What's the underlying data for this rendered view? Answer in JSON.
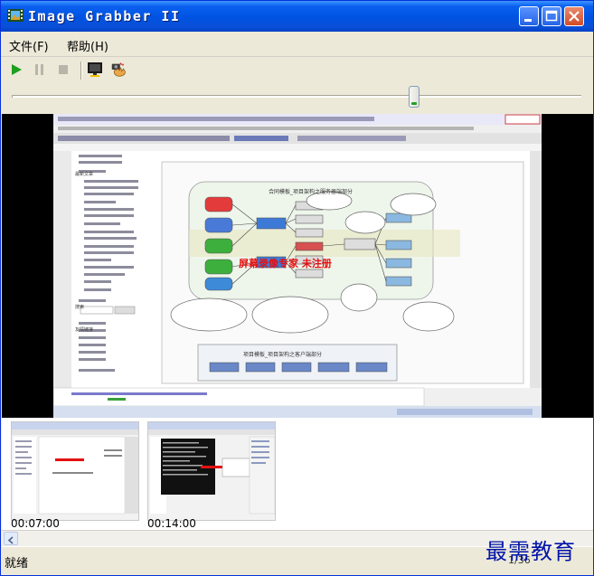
{
  "window": {
    "title": "Image Grabber II"
  },
  "menu": {
    "file": "文件(F)",
    "help": "帮助(H)"
  },
  "toolbar": {
    "icons": [
      "play-icon",
      "pause-icon",
      "stop-icon",
      "monitor-icon",
      "camera-hand-icon"
    ]
  },
  "slider": {
    "position_fraction": 0.72
  },
  "preview": {
    "overlay_text": "屏幕录像专家 未注册",
    "diagram_title": "合同模板_项目架构之服务器端部分",
    "bottom_title": "项目模板_项目架构之客户端部分",
    "nav_header": "最新文章",
    "search_label": "搜索",
    "section_label": "友情链接"
  },
  "thumbnails": [
    {
      "time": "00:07:00"
    },
    {
      "time": "00:14:00"
    }
  ],
  "status": {
    "text": "就绪",
    "right": "1/36"
  },
  "watermark": "最需教育",
  "colors": {
    "title_bar": "#0053E1",
    "window_bg": "#ECE9D8",
    "overlay_red": "#E51010",
    "play_green": "#1F9E1F",
    "watermark_blue": "#0013A8"
  }
}
